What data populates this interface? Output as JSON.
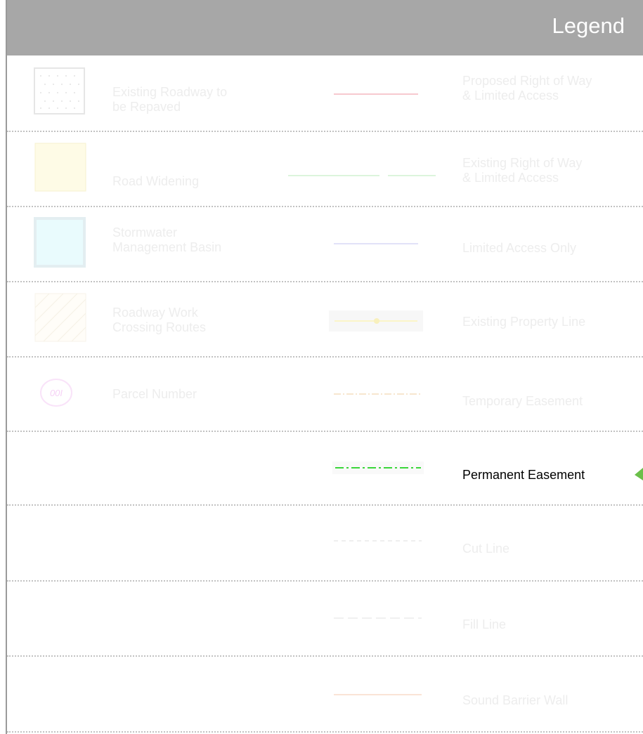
{
  "legend": {
    "title": "Legend",
    "colors": {
      "header_bg": "#a7a7a7",
      "faded_text": "#ededed",
      "active_text": "#000000",
      "permanent_easement_green": "#3ad63a",
      "arrow_green": "#6bbf4a"
    },
    "left_items": [
      {
        "label": "Existing Roadway to\nbe Repaved",
        "swatch": "dotted-square"
      },
      {
        "label": "Road Widening",
        "swatch": "yellow-square"
      },
      {
        "label": "Stormwater\nManagement Basin",
        "swatch": "cyan-square"
      },
      {
        "label": "Roadway Work\nCrossing Routes",
        "swatch": "hatched-square"
      },
      {
        "label": "Parcel Number",
        "swatch": "parcel-circle",
        "symbol_text": "00I"
      }
    ],
    "right_items": [
      {
        "label": "Proposed Right of Way\n& Limited Access",
        "line": "red-line"
      },
      {
        "label": "Existing Right of Way\n& Limited Access",
        "line": "green-line"
      },
      {
        "label": "Limited Access Only",
        "line": "blue-line"
      },
      {
        "label": "Existing Property Line",
        "line": "yellow-dot-line"
      },
      {
        "label": "Temporary Easement",
        "line": "orange-dashdot-line"
      },
      {
        "label": "Permanent Easement",
        "line": "green-dashdot-line",
        "highlighted": true
      },
      {
        "label": "Cut Line",
        "line": "gray-dashed-line"
      },
      {
        "label": "Fill Line",
        "line": "gray-longdash-line"
      },
      {
        "label": "Sound Barrier Wall",
        "line": "orange-line"
      }
    ]
  }
}
